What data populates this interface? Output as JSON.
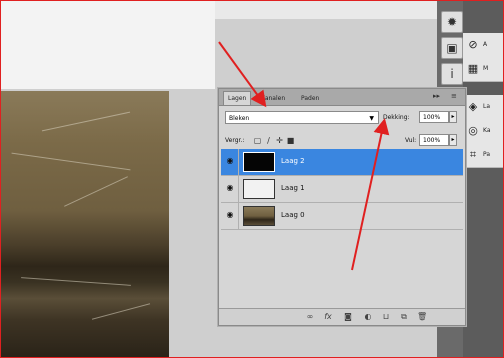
{
  "layers_panel": {
    "tabs": [
      {
        "label": "Lagen",
        "active": true
      },
      {
        "label": "Kanalen",
        "active": false
      },
      {
        "label": "Paden",
        "active": false
      }
    ],
    "blend_mode": "Bleken",
    "opacity_label": "Dekking:",
    "opacity_value": "100%",
    "lock_label": "Vergr.:",
    "fill_label": "Vul:",
    "fill_value": "100%",
    "layers": [
      {
        "name": "Laag 2",
        "selected": true
      },
      {
        "name": "Laag 1",
        "selected": false
      },
      {
        "name": "Laag 0",
        "selected": false
      }
    ]
  },
  "side_panel": {
    "items": [
      {
        "icon": "brush-icon",
        "label": "A"
      },
      {
        "icon": "grid-icon",
        "label": "M"
      },
      {
        "icon": "layers-icon",
        "label": "La"
      },
      {
        "icon": "channels-icon",
        "label": "Ka"
      },
      {
        "icon": "paths-icon",
        "label": "Pa"
      }
    ]
  },
  "colors": {
    "selected_layer": "#3a86e0",
    "annotation_arrow": "#e02020",
    "frame_border": "#e02020"
  }
}
